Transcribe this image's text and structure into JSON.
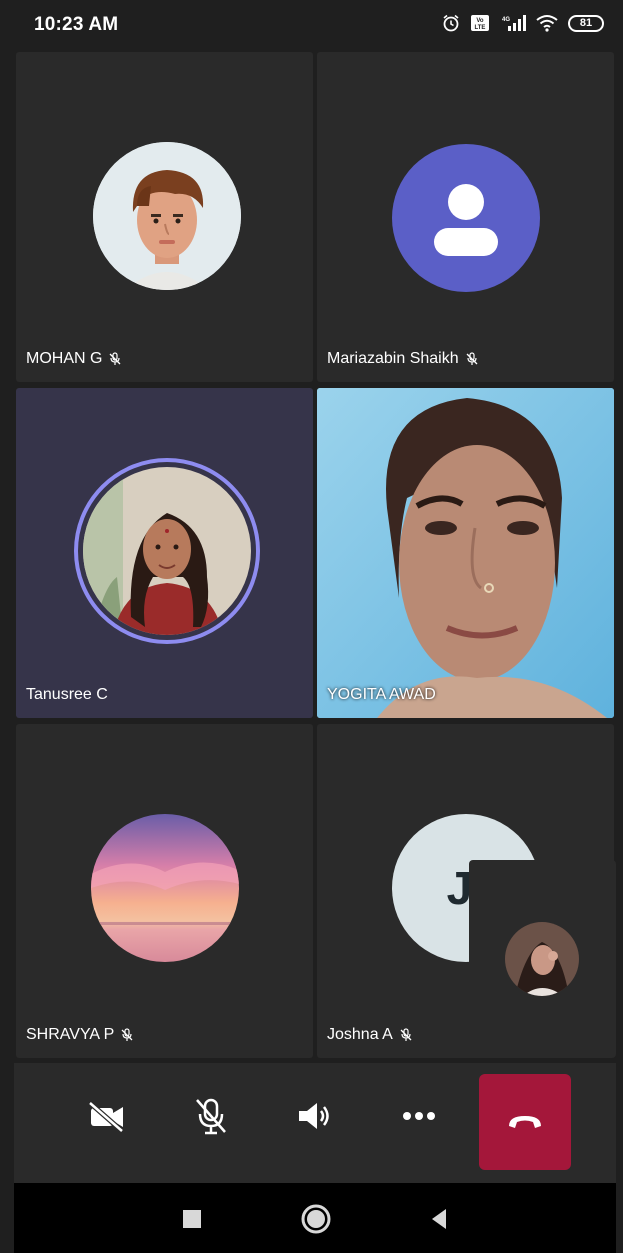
{
  "status_bar": {
    "time": "10:23 AM",
    "battery": "81",
    "icons": [
      "alarm-icon",
      "volte-icon",
      "signal-4g-icon",
      "wifi-icon",
      "battery-icon"
    ]
  },
  "participants": [
    {
      "name": "MOHAN G",
      "muted": true,
      "avatar": "illustrated-face-avatar"
    },
    {
      "name": "Mariazabin Shaikh",
      "muted": true,
      "avatar": "generic-person-avatar"
    },
    {
      "name": "Tanusree C",
      "muted": false,
      "speaking": true,
      "avatar": "photo-avatar"
    },
    {
      "name": "YOGITA AWAD",
      "muted": false,
      "avatar": "live-video"
    },
    {
      "name": "SHRAVYA P",
      "muted": true,
      "avatar": "sunset-photo-avatar"
    },
    {
      "name": "Joshna A",
      "muted": true,
      "avatar": "initials-avatar",
      "initials": "JA"
    }
  ],
  "controls": {
    "icons": [
      "video-off-icon",
      "mic-off-icon",
      "speaker-icon",
      "more-icon",
      "hang-up-icon"
    ]
  },
  "navbar": {
    "icons": [
      "recents-icon",
      "home-icon",
      "back-icon"
    ]
  },
  "colors": {
    "background": "#1f1f1f",
    "tile": "#2a2a2a",
    "active_tile": "#36344a",
    "hangup": "#a4173a",
    "generic_avatar": "#5b5fc7",
    "speaking_ring": "#8e8cf0"
  }
}
